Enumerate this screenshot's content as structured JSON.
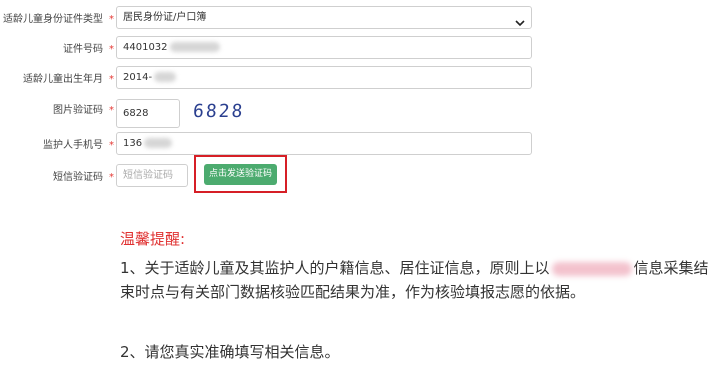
{
  "form": {
    "id_type": {
      "label": "适龄儿童身份证件类型",
      "value": "居民身份证/户口簿"
    },
    "id_number": {
      "label": "证件号码",
      "value": "4401032"
    },
    "birth": {
      "label": "适龄儿童出生年月",
      "value": "2014-"
    },
    "captcha": {
      "label": "图片验证码",
      "value": "6828",
      "image_text": "6828"
    },
    "phone": {
      "label": "监护人手机号",
      "value": "136"
    },
    "sms": {
      "label": "短信验证码",
      "placeholder": "短信验证码",
      "button": "点击发送验证码"
    },
    "required_mark": "*"
  },
  "notice": {
    "title": "温馨提醒:",
    "p1_before": "1、关于适龄儿童及其监护人的户籍信息、居住证信息，原则上以",
    "p1_after": "信息采集结束时点与有关部门数据核验匹配结果为准，作为核验填报志愿的依据。",
    "p2": "2、请您真实准确填写相关信息。"
  },
  "colors": {
    "required": "#e53935",
    "sms_button": "#4cab6f",
    "highlight_box": "#d61f26",
    "notice_title": "#e03030",
    "captcha_text": "#2a3f8f"
  },
  "icons": {
    "select_arrow": "chevron-down-icon"
  }
}
